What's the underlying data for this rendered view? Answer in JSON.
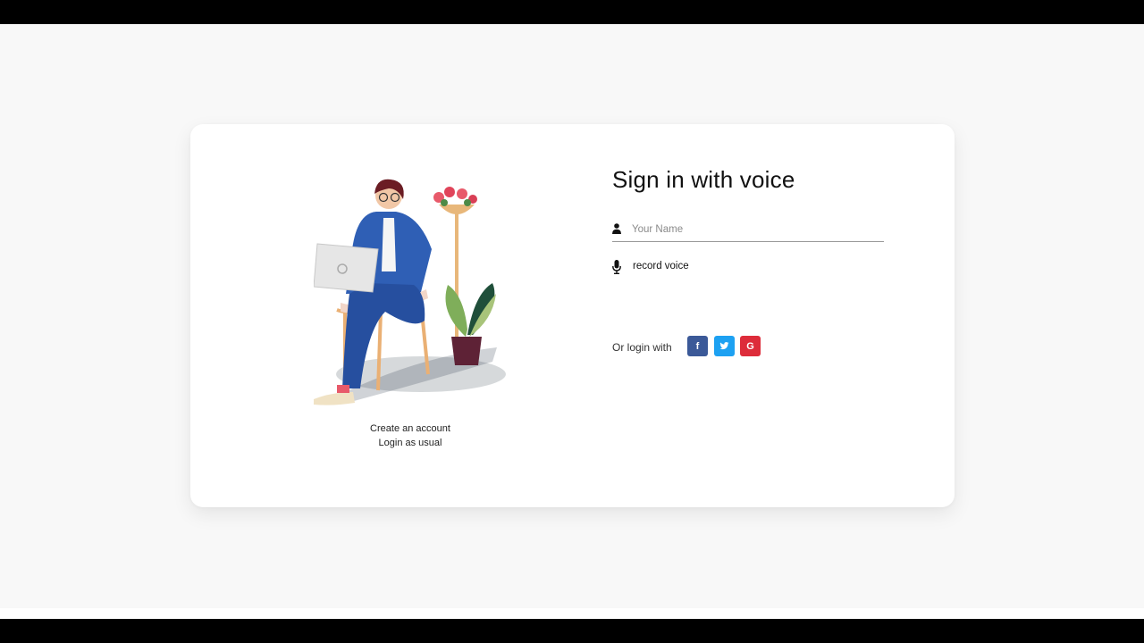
{
  "page": {
    "title": "Sign in with voice"
  },
  "form": {
    "name_placeholder": "Your Name",
    "name_value": "",
    "record_voice_label": "record voice"
  },
  "left": {
    "create_account": "Create an account",
    "login_usual": "Login as usual"
  },
  "social": {
    "label": "Or login with",
    "buttons": [
      {
        "name": "facebook",
        "glyph": "f",
        "color": "#3b5998",
        "icon": "facebook-icon"
      },
      {
        "name": "twitter",
        "glyph": "twitter-bird",
        "color": "#1da1f2",
        "icon": "twitter-icon"
      },
      {
        "name": "google",
        "glyph": "G",
        "color": "#dd2c3a",
        "icon": "google-icon"
      }
    ]
  },
  "colors": {
    "background": "#f8f8f8",
    "card": "#ffffff",
    "text": "#111111",
    "underline": "#9a9a9a"
  },
  "icons": {
    "name_field": "user-icon",
    "voice": "microphone-icon"
  }
}
